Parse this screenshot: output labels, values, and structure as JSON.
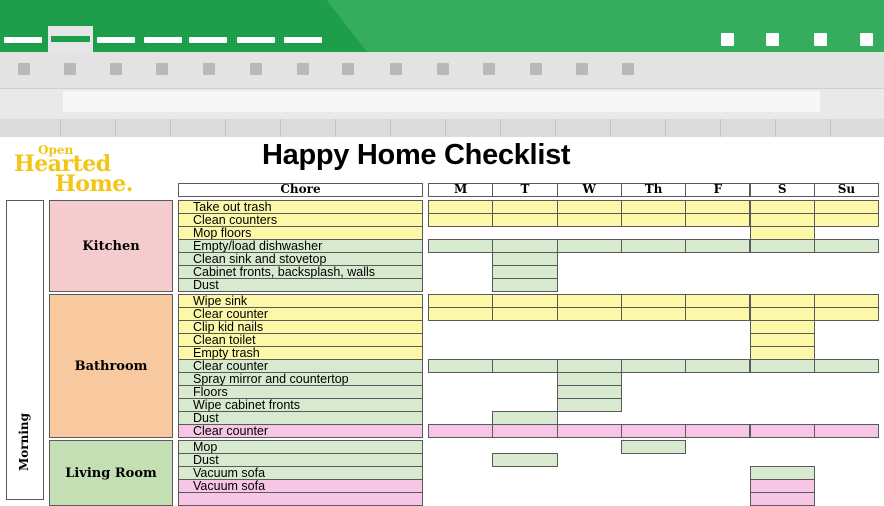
{
  "colors": {
    "chrome_green": "#1e9e4a",
    "yellow": "#fdf7a8",
    "green": "#d7e9cf",
    "pink": "#f7c6e6",
    "room_kitchen": "#f5cccd",
    "room_bathroom": "#f8c99e",
    "room_living": "#c3dfb3",
    "logo": "#f2c617"
  },
  "logo": {
    "line1": "Open",
    "line2": "Hearted",
    "line3": "Home."
  },
  "sheet_title": "Happy Home Checklist",
  "header": {
    "chore": "Chore",
    "days": [
      "M",
      "T",
      "W",
      "Th",
      "F",
      "S",
      "Su"
    ]
  },
  "period": "Morning",
  "rooms": [
    {
      "name": "Kitchen",
      "color": "#f5cccd"
    },
    {
      "name": "Bathroom",
      "color": "#f8c99e"
    },
    {
      "name": "Living Room",
      "color": "#c3dfb3"
    }
  ],
  "rows": [
    {
      "room": 0,
      "chore": "Take out trash",
      "color": "yellow",
      "days": [
        0,
        1,
        2,
        3,
        4,
        5,
        6
      ]
    },
    {
      "room": 0,
      "chore": "Clean counters",
      "color": "yellow",
      "days": [
        0,
        1,
        2,
        3,
        4,
        5,
        6
      ]
    },
    {
      "room": 0,
      "chore": "Mop floors",
      "color": "yellow",
      "days": [
        5
      ]
    },
    {
      "room": 0,
      "chore": "Empty/load dishwasher",
      "color": "green",
      "days": [
        0,
        1,
        2,
        3,
        4,
        5,
        6
      ]
    },
    {
      "room": 0,
      "chore": "Clean sink and stovetop",
      "color": "green",
      "days": [
        1
      ]
    },
    {
      "room": 0,
      "chore": "Cabinet fronts, backsplash, walls",
      "color": "green",
      "days": [
        1
      ]
    },
    {
      "room": 0,
      "chore": "Dust",
      "color": "green",
      "days": [
        1
      ]
    },
    {
      "gap": true
    },
    {
      "room": 1,
      "chore": "Wipe sink",
      "color": "yellow",
      "days": [
        0,
        1,
        2,
        3,
        4,
        5,
        6
      ]
    },
    {
      "room": 1,
      "chore": "Clear counter",
      "color": "yellow",
      "days": [
        0,
        1,
        2,
        3,
        4,
        5,
        6
      ]
    },
    {
      "room": 1,
      "chore": "Clip kid nails",
      "color": "yellow",
      "days": [
        5
      ]
    },
    {
      "room": 1,
      "chore": "Clean toilet",
      "color": "yellow",
      "days": [
        5
      ]
    },
    {
      "room": 1,
      "chore": "Empty trash",
      "color": "yellow",
      "days": [
        5
      ]
    },
    {
      "room": 1,
      "chore": "Clear counter",
      "color": "green",
      "days": [
        0,
        1,
        2,
        3,
        4,
        5,
        6
      ]
    },
    {
      "room": 1,
      "chore": "Spray mirror and countertop",
      "color": "green",
      "days": [
        2
      ]
    },
    {
      "room": 1,
      "chore": "Floors",
      "color": "green",
      "days": [
        2
      ]
    },
    {
      "room": 1,
      "chore": "Wipe cabinet fronts",
      "color": "green",
      "days": [
        2
      ]
    },
    {
      "room": 1,
      "chore": "Dust",
      "color": "green",
      "days": [
        1
      ]
    },
    {
      "room": 1,
      "chore": "Clear counter",
      "color": "pink",
      "days": [
        0,
        1,
        2,
        3,
        4,
        5,
        6
      ]
    },
    {
      "gap": true
    },
    {
      "room": 2,
      "chore": "Mop",
      "color": "green",
      "days": [
        3
      ]
    },
    {
      "room": 2,
      "chore": "Dust",
      "color": "green",
      "days": [
        1
      ]
    },
    {
      "room": 2,
      "chore": "Vacuum sofa",
      "color": "green",
      "days": [
        5
      ]
    },
    {
      "room": 2,
      "chore": "Vacuum sofa",
      "color": "pink",
      "days": [
        5
      ]
    },
    {
      "room": 2,
      "chore": "",
      "color": "pink",
      "days": [
        5
      ]
    }
  ]
}
